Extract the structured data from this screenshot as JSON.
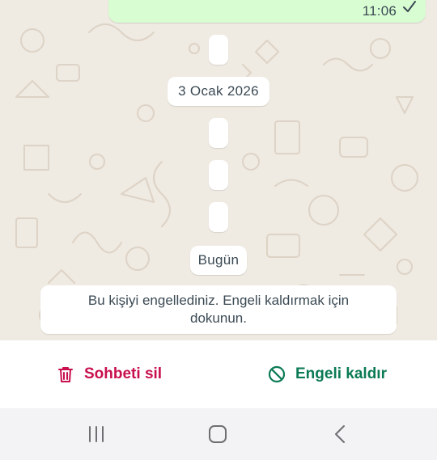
{
  "chat": {
    "last_message_time": "11:06",
    "date_chip_1": "3 Ocak 2026",
    "date_chip_2": "Bugün",
    "blocked_notice": "Bu kişiyi engellediniz. Engeli kaldırmak için dokunun."
  },
  "actions": {
    "delete_chat_label": "Sohbeti sil",
    "unblock_label": "Engeli kaldır"
  },
  "colors": {
    "chat_background": "#efeae2",
    "outgoing_bubble": "#d9fdd3",
    "delete_red": "#c8104d",
    "unblock_green": "#0b7a55",
    "nav_bar": "#f3f3f5"
  },
  "icons": {
    "read_check": "check-icon",
    "delete": "trash-icon",
    "unblock": "block-icon",
    "recent_apps": "recent-apps-icon",
    "home": "home-icon",
    "back": "back-icon"
  }
}
